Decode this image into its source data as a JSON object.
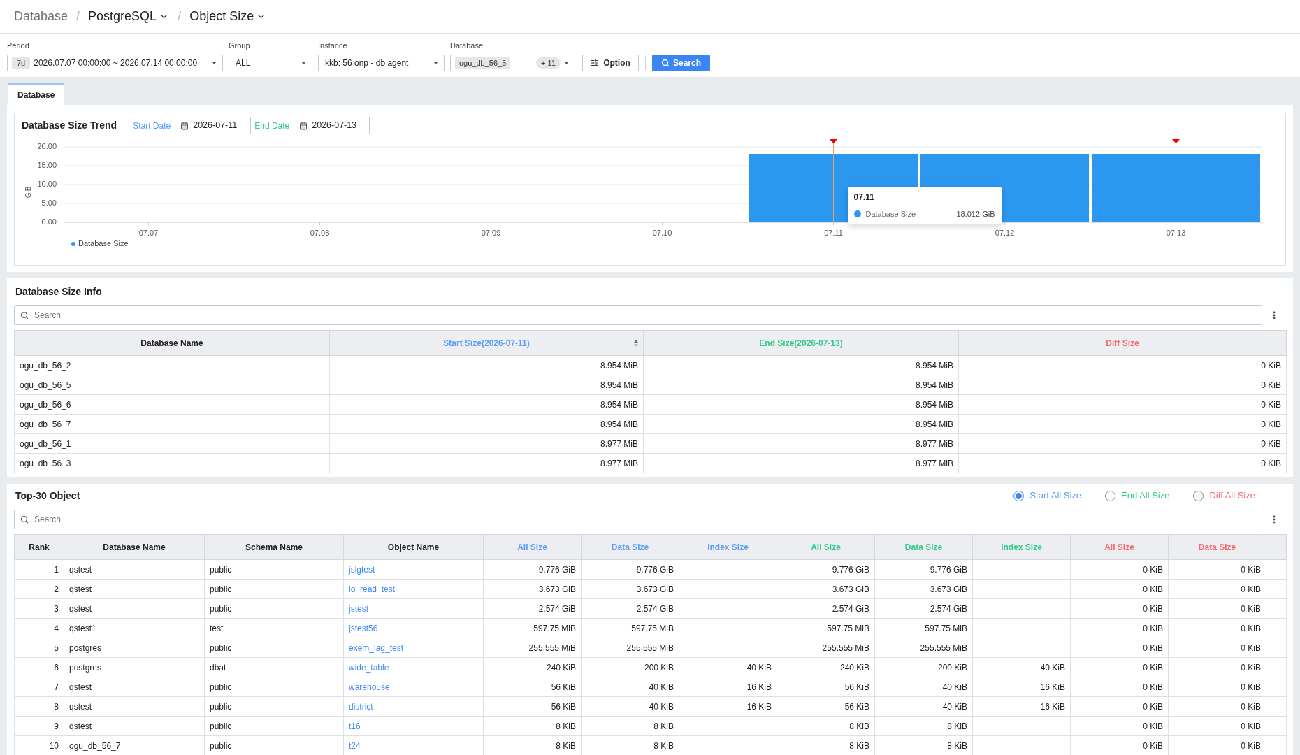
{
  "breadcrumb": {
    "separator": "/",
    "items": [
      {
        "label": "Database",
        "dropdown": false
      },
      {
        "label": "PostgreSQL",
        "dropdown": true
      },
      {
        "label": "Object Size",
        "dropdown": true
      }
    ]
  },
  "filters": [
    {
      "kind": "period",
      "label": "Period",
      "badge": "7d",
      "value": "2026.07.07 00:00:00 ~ 2026.07.14 00:00:00"
    },
    {
      "kind": "select",
      "label": "Group",
      "value": "ALL"
    },
    {
      "kind": "select",
      "label": "Instance",
      "value": "kkb: 56 onp - db agent"
    },
    {
      "kind": "multi",
      "label": "Database",
      "value": "ogu_db_56_5",
      "count": "+ 11"
    }
  ],
  "buttons": [
    {
      "kind": "option",
      "label": "Option"
    },
    {
      "kind": "search",
      "label": "Search"
    }
  ],
  "tabs": [
    {
      "label": "Database",
      "selected": true
    }
  ],
  "trend": {
    "date_range": [
      {
        "label": "Start Date",
        "value": "2026-07-11",
        "color": "#5a9ef6"
      },
      {
        "label": "End Date",
        "value": "2026-07-13",
        "color": "#34c98b"
      }
    ],
    "chart_data": {
      "type": "bar",
      "title": "Database Size Trend",
      "ylabel": "GiB",
      "categories": [
        "07.07",
        "07.08",
        "07.09",
        "07.10",
        "07.11",
        "07.12",
        "07.13"
      ],
      "series": [
        {
          "name": "Database Size",
          "color": "#2b97ef",
          "values": [
            0,
            0,
            0,
            0,
            18.0,
            18.0,
            18.0
          ]
        }
      ],
      "ylim": [
        0,
        20
      ],
      "yticks": [
        {
          "value": 0,
          "label": "0.00"
        },
        {
          "value": 5,
          "label": "5.00"
        },
        {
          "value": 10,
          "label": "10.00"
        },
        {
          "value": 15,
          "label": "15.00"
        },
        {
          "value": 20,
          "label": "20.00"
        }
      ],
      "grid": true
    },
    "tooltip": {
      "title": "07.11",
      "series": "Database Size",
      "value": "18.012 GiB"
    }
  },
  "size_info": {
    "title": "Database Size Info",
    "search": {
      "placeholder": "Search"
    },
    "columns": [
      {
        "label": "Database Name",
        "kind": "text",
        "sortable": false
      },
      {
        "label": "Start Size(2026-07-11)",
        "kind": "number",
        "color": "#5a9ef6",
        "sortable": true
      },
      {
        "label": "End Size(2026-07-13)",
        "kind": "number",
        "color": "#34c98b",
        "sortable": false
      },
      {
        "label": "Diff Size",
        "kind": "number",
        "color": "#f5686b",
        "sortable": false
      }
    ],
    "rows": [
      [
        "ogu_db_56_2",
        "8.954 MiB",
        "8.954 MiB",
        "0 KiB"
      ],
      [
        "ogu_db_56_5",
        "8.954 MiB",
        "8.954 MiB",
        "0 KiB"
      ],
      [
        "ogu_db_56_6",
        "8.954 MiB",
        "8.954 MiB",
        "0 KiB"
      ],
      [
        "ogu_db_56_7",
        "8.954 MiB",
        "8.954 MiB",
        "0 KiB"
      ],
      [
        "ogu_db_56_1",
        "8.977 MiB",
        "8.977 MiB",
        "0 KiB"
      ],
      [
        "ogu_db_56_3",
        "8.977 MiB",
        "8.977 MiB",
        "0 KiB"
      ]
    ]
  },
  "top_objects": {
    "title": "Top-30 Object",
    "radios": [
      {
        "label": "Start All Size",
        "selected": true,
        "color": "#5a9ef6"
      },
      {
        "label": "End All Size",
        "selected": false,
        "color": "#34c98b"
      },
      {
        "label": "Diff All Size",
        "selected": false,
        "color": "#f5686b"
      }
    ],
    "search": {
      "placeholder": "Search"
    },
    "columns": [
      {
        "label": "Rank",
        "kind": "number"
      },
      {
        "label": "Database Name",
        "kind": "text"
      },
      {
        "label": "Schema Name",
        "kind": "text"
      },
      {
        "label": "Object Name",
        "kind": "link"
      },
      {
        "label": "All Size",
        "kind": "number",
        "color": "#5a9ef6"
      },
      {
        "label": "Data Size",
        "kind": "number",
        "color": "#5a9ef6"
      },
      {
        "label": "Index Size",
        "kind": "number",
        "color": "#5a9ef6"
      },
      {
        "label": "All Size",
        "kind": "number",
        "color": "#34c98b"
      },
      {
        "label": "Data Size",
        "kind": "number",
        "color": "#34c98b"
      },
      {
        "label": "Index Size",
        "kind": "number",
        "color": "#34c98b"
      },
      {
        "label": "All Size",
        "kind": "number",
        "color": "#f5686b"
      },
      {
        "label": "Data Size",
        "kind": "number",
        "color": "#f5686b"
      }
    ],
    "rows": [
      [
        "1",
        "qstest",
        "public",
        "jslgtest",
        "9.776 GiB",
        "9.776 GiB",
        null,
        "9.776 GiB",
        "9.776 GiB",
        null,
        "0 KiB",
        "0 KiB"
      ],
      [
        "2",
        "qstest",
        "public",
        "io_read_test",
        "3.673 GiB",
        "3.673 GiB",
        null,
        "3.673 GiB",
        "3.673 GiB",
        null,
        "0 KiB",
        "0 KiB"
      ],
      [
        "3",
        "qstest",
        "public",
        "jstest",
        "2.574 GiB",
        "2.574 GiB",
        null,
        "2.574 GiB",
        "2.574 GiB",
        null,
        "0 KiB",
        "0 KiB"
      ],
      [
        "4",
        "qstest1",
        "test",
        "jstest56",
        "597.75 MiB",
        "597.75 MiB",
        null,
        "597.75 MiB",
        "597.75 MiB",
        null,
        "0 KiB",
        "0 KiB"
      ],
      [
        "5",
        "postgres",
        "public",
        "exem_lag_test",
        "255.555 MiB",
        "255.555 MiB",
        null,
        "255.555 MiB",
        "255.555 MiB",
        null,
        "0 KiB",
        "0 KiB"
      ],
      [
        "6",
        "postgres",
        "dbat",
        "wide_table",
        "240 KiB",
        "200 KiB",
        "40 KiB",
        "240 KiB",
        "200 KiB",
        "40 KiB",
        "0 KiB",
        "0 KiB"
      ],
      [
        "7",
        "qstest",
        "public",
        "warehouse",
        "56 KiB",
        "40 KiB",
        "16 KiB",
        "56 KiB",
        "40 KiB",
        "16 KiB",
        "0 KiB",
        "0 KiB"
      ],
      [
        "8",
        "qstest",
        "public",
        "district",
        "56 KiB",
        "40 KiB",
        "16 KiB",
        "56 KiB",
        "40 KiB",
        "16 KiB",
        "0 KiB",
        "0 KiB"
      ],
      [
        "9",
        "qstest",
        "public",
        "t16",
        "8 KiB",
        "8 KiB",
        null,
        "8 KiB",
        "8 KiB",
        null,
        "0 KiB",
        "0 KiB"
      ],
      [
        "10",
        "ogu_db_56_7",
        "public",
        "t24",
        "8 KiB",
        "8 KiB",
        null,
        "8 KiB",
        "8 KiB",
        null,
        "0 KiB",
        "0 KiB"
      ]
    ]
  }
}
